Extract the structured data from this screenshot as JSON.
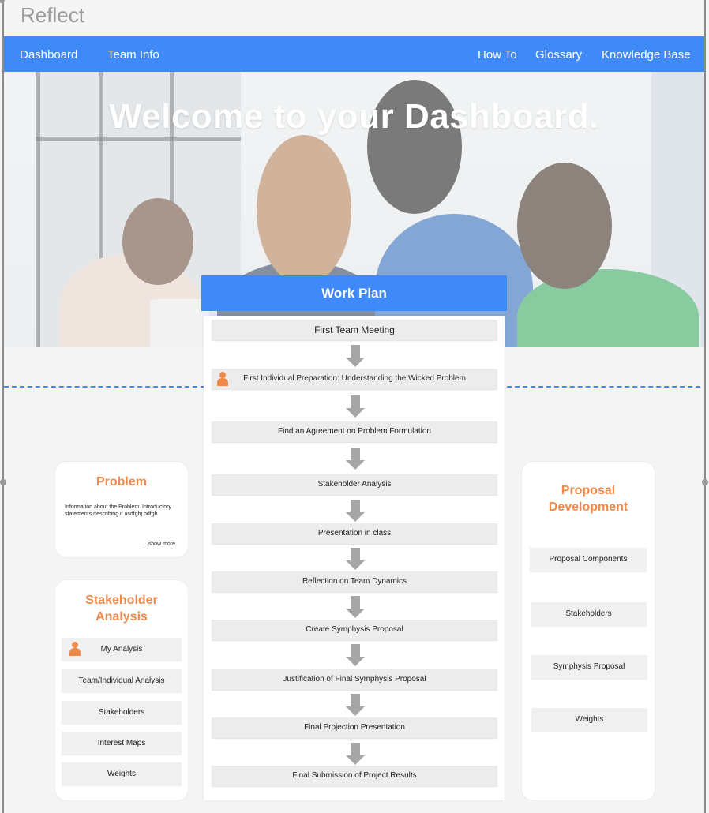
{
  "app": {
    "title": "Reflect"
  },
  "nav": {
    "left": [
      {
        "label": "Dashboard"
      },
      {
        "label": "Team Info"
      }
    ],
    "right": [
      {
        "label": "How To"
      },
      {
        "label": "Glossary"
      },
      {
        "label": "Knowledge Base"
      }
    ]
  },
  "hero": {
    "title": "Welcome to your Dashboard."
  },
  "work_plan": {
    "title": "Work Plan",
    "steps": [
      {
        "label": "First Team Meeting"
      },
      {
        "label": "First Individual Preparation: Understanding the Wicked Problem"
      },
      {
        "label": "Find an Agreement on Problem Formulation"
      },
      {
        "label": "Stakeholder Analysis"
      },
      {
        "label": "Presentation in class"
      },
      {
        "label": "Reflection on Team Dynamics"
      },
      {
        "label": "Create Symphysis Proposal"
      },
      {
        "label": "Justification of Final Symphysis Proposal"
      },
      {
        "label": "Final Projection Presentation"
      },
      {
        "label": "Final Submission of Project Results"
      }
    ]
  },
  "problem": {
    "title": "Problem",
    "text": "Information about the Problem. Introductory statements describing it asdfghj bdfgh",
    "show_more": "... show more"
  },
  "stakeholder_analysis": {
    "title_line1": "Stakeholder",
    "title_line2": "Analysis",
    "items": [
      {
        "label": "My Analysis"
      },
      {
        "label": "Team/Individual Analysis"
      },
      {
        "label": "Stakeholders"
      },
      {
        "label": "Interest Maps"
      },
      {
        "label": "Weights"
      }
    ]
  },
  "proposal_development": {
    "title_line1": "Proposal",
    "title_line2": "Development",
    "items": [
      {
        "label": "Proposal Components"
      },
      {
        "label": "Stakeholders"
      },
      {
        "label": "Symphysis Proposal"
      },
      {
        "label": "Weights"
      }
    ]
  },
  "colors": {
    "accent": "#3f89f8",
    "card_title": "#f08a4b",
    "arrow": "#a6a6a6"
  },
  "icons": {
    "person": "person-icon",
    "arrow": "arrow-down-icon"
  }
}
